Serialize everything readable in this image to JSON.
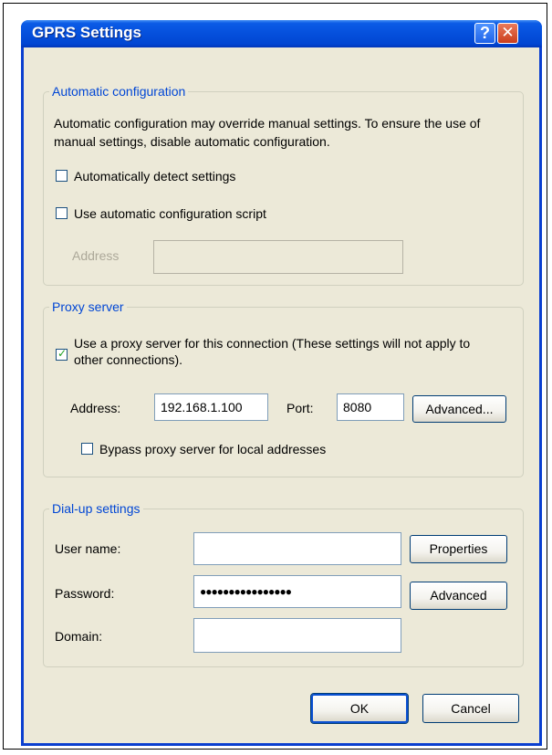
{
  "window": {
    "title": "GPRS Settings",
    "help_glyph": "?",
    "close_glyph": "✕"
  },
  "auto_config": {
    "legend": "Automatic configuration",
    "description": "Automatic configuration may override manual settings.  To ensure the use of manual settings, disable automatic configuration.",
    "detect_label": "Automatically detect settings",
    "script_label": "Use automatic configuration script",
    "address_label": "Address",
    "address_value": ""
  },
  "proxy": {
    "legend": "Proxy server",
    "use_proxy_label": "Use a proxy server for this connection (These settings will not apply to other connections).",
    "use_proxy_checked": true,
    "address_label": "Address:",
    "address_value": "192.168.1.100",
    "port_label": "Port:",
    "port_value": "8080",
    "advanced_button": "Advanced...",
    "bypass_label": "Bypass proxy server for local addresses",
    "bypass_checked": false
  },
  "dialup": {
    "legend": "Dial-up settings",
    "username_label": "User name:",
    "username_value": "",
    "password_label": "Password:",
    "password_value": "●●●●●●●●●●●●●●●●",
    "domain_label": "Domain:",
    "domain_value": "",
    "properties_button": "Properties",
    "advanced_button": "Advanced"
  },
  "footer": {
    "ok_button": "OK",
    "cancel_button": "Cancel"
  },
  "colors": {
    "titlebar": "#0550dc",
    "dialog_bg": "#ece9d8",
    "legend_text": "#0046d5",
    "check_mark": "#21a121"
  }
}
